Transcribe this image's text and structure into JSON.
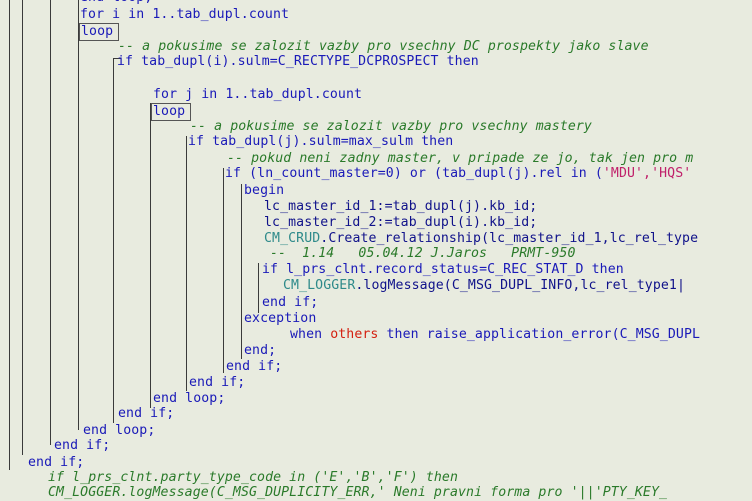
{
  "code": {
    "l00": [
      {
        "t": "end loop;",
        "c": "kw"
      }
    ],
    "l01": [
      {
        "t": "for i in 1..tab_dupl.count",
        "c": "kw"
      }
    ],
    "l02": [
      {
        "t": "loop",
        "c": "kw"
      }
    ],
    "l03": [
      {
        "t": "-- a pokusime se zalozit vazby pro vsechny DC prospekty jako slave",
        "c": "cmt"
      }
    ],
    "l04": [
      {
        "t": "if tab_dupl(i).sulm=C_RECTYPE_DCPROSPECT then",
        "c": "kw"
      }
    ],
    "l05": [
      {
        "t": "for j in 1..tab_dupl.count",
        "c": "kw"
      }
    ],
    "l06": [
      {
        "t": "loop",
        "c": "kw"
      }
    ],
    "l07": [
      {
        "t": "-- a pokusime se zalozit vazby pro vsechny mastery",
        "c": "cmt"
      }
    ],
    "l08": [
      {
        "t": "if tab_dupl(j).sulm=max_sulm then",
        "c": "kw"
      }
    ],
    "l09": [
      {
        "t": "-- pokud neni zadny master, v pripade ze jo, tak jen pro m",
        "c": "cmt"
      }
    ],
    "l10": [
      {
        "t": "if (ln_count_master=0) or (tab_dupl(j).rel in (",
        "c": "kw"
      },
      {
        "t": "'MDU','HQS'",
        "c": "str"
      }
    ],
    "l11": [
      {
        "t": "begin",
        "c": "kw"
      }
    ],
    "l12": [
      {
        "t": "lc_master_id_1:=tab_dupl(j).kb_id;",
        "c": ""
      }
    ],
    "l13": [
      {
        "t": "lc_master_id_2:=tab_dupl(i).kb_id;",
        "c": ""
      }
    ],
    "l14": [
      {
        "t": "CM_CRUD",
        "c": "fn"
      },
      {
        "t": ".Create_relationship(lc_master_id_1,lc_rel_type",
        "c": ""
      }
    ],
    "l15": [
      {
        "t": "--  1.14   05.04.12 J.Jaros   PRMT-950",
        "c": "cmt"
      }
    ],
    "l16": [
      {
        "t": "if l_prs_clnt.record_status=C_REC_STAT_D then",
        "c": "kw"
      }
    ],
    "l17": [
      {
        "t": "CM_LOGGER",
        "c": "fn"
      },
      {
        "t": ".logMessage(C_MSG_DUPL_INFO,lc_rel_type1|",
        "c": ""
      }
    ],
    "l18": [
      {
        "t": "end if;",
        "c": "kw"
      }
    ],
    "l19": [
      {
        "t": "exception",
        "c": "kw"
      }
    ],
    "l20": [
      {
        "t": "when ",
        "c": "kw"
      },
      {
        "t": "others",
        "c": "red"
      },
      {
        "t": " then raise_application_error(C_MSG_DUPL",
        "c": "kw"
      }
    ],
    "l21": [
      {
        "t": "end;",
        "c": "kw"
      }
    ],
    "l22": [
      {
        "t": "end if;",
        "c": "kw"
      }
    ],
    "l23": [
      {
        "t": "end if;",
        "c": "kw"
      }
    ],
    "l24": [
      {
        "t": "end loop;",
        "c": "kw"
      }
    ],
    "l25": [
      {
        "t": "end if;",
        "c": "kw"
      }
    ],
    "l26": [
      {
        "t": "end loop;",
        "c": "kw"
      }
    ],
    "l27": [
      {
        "t": "end if;",
        "c": "kw"
      }
    ],
    "l28": [
      {
        "t": "end if;",
        "c": "kw"
      }
    ],
    "l29": [
      {
        "t": "if l_prs_clnt.party_type_code in ('E','B','F') then",
        "c": "cmt"
      }
    ],
    "l30": [
      {
        "t": "CM_LOGGER.logMessage(C_MSG_DUPLICITY_ERR,' Neni pravni forma pro '||'PTY_KEY_",
        "c": "cmt"
      }
    ]
  }
}
